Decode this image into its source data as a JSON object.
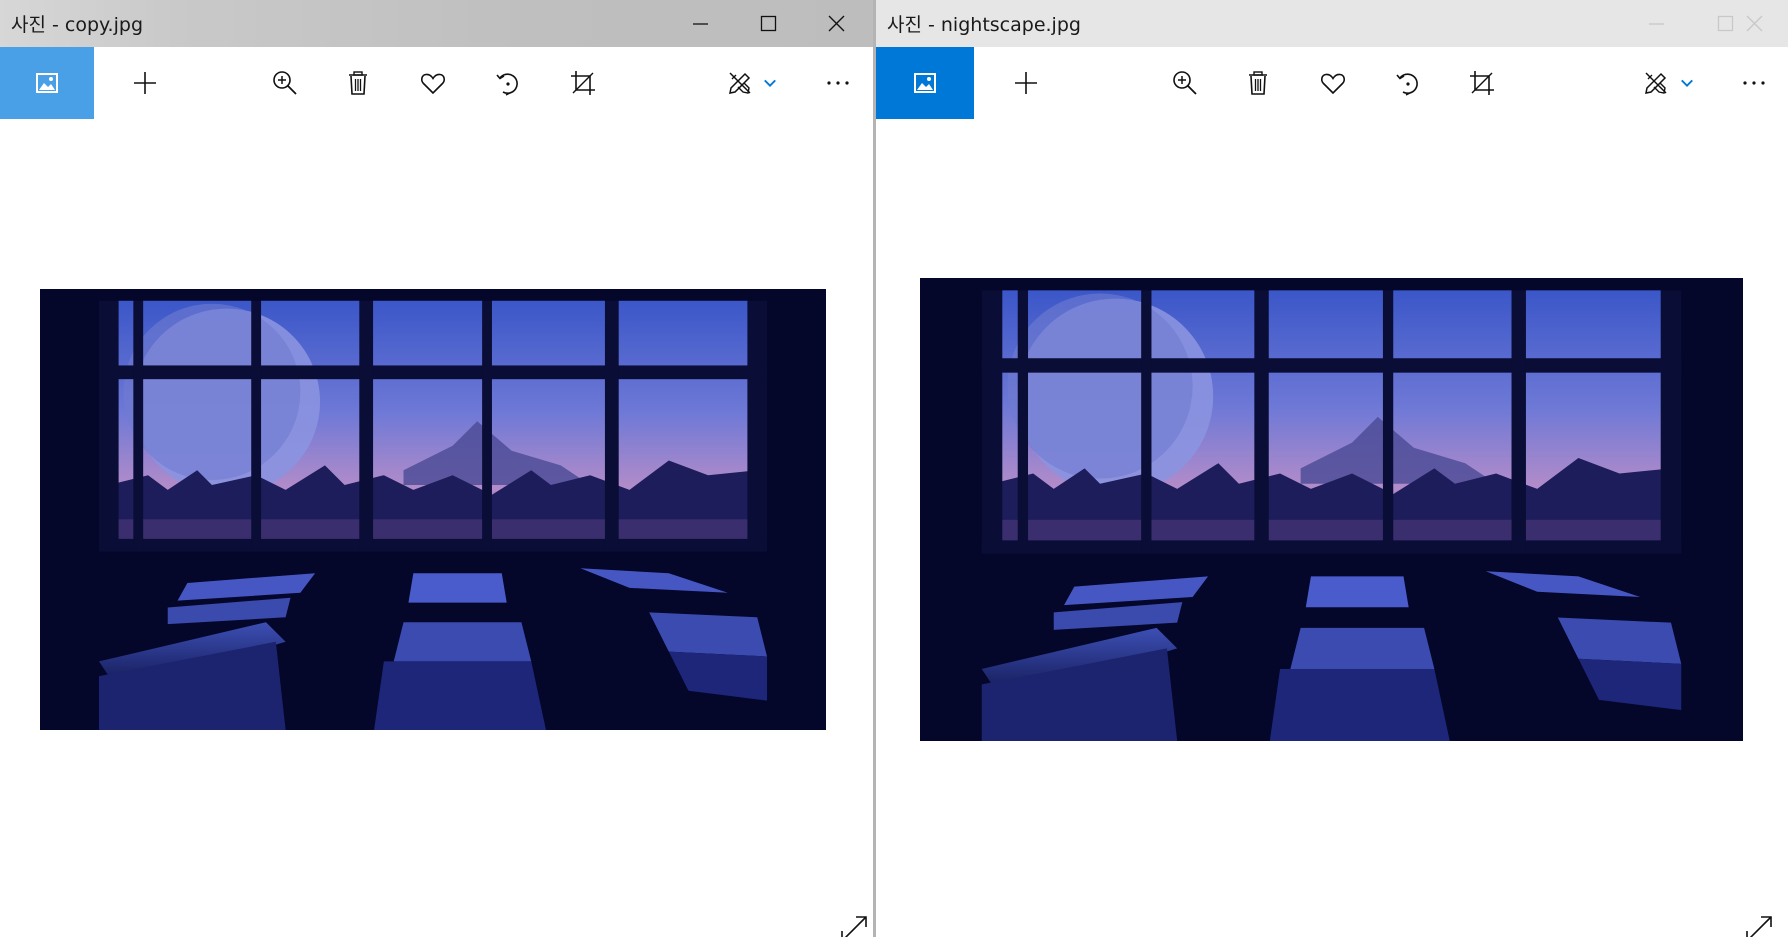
{
  "windows": [
    {
      "title": "사진 - copy.jpg",
      "active_color": "#4aa0e6",
      "titlebar_state": "active",
      "photo": {
        "description_icon": "photo-image"
      }
    },
    {
      "title": "사진 - nightscape.jpg",
      "active_color": "#0078d7",
      "titlebar_state": "inactive",
      "photo": {
        "description_icon": "photo-image"
      }
    }
  ],
  "toolbar_icons": [
    "gallery-icon",
    "add-icon",
    "zoom-in-icon",
    "delete-icon",
    "favorite-icon",
    "rotate-icon",
    "crop-icon",
    "edit-draw-icon",
    "chevron-down-icon",
    "more-icon"
  ],
  "window_controls": [
    "minimize-icon",
    "maximize-icon",
    "close-icon"
  ],
  "accent_chevron": "#0078d7"
}
